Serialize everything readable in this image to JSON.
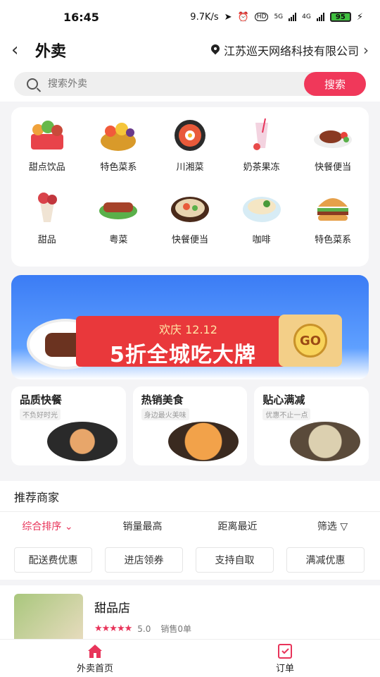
{
  "status": {
    "time": "16:45",
    "speed": "9.7K/s",
    "hd": "HD",
    "net1": "5G",
    "net2": "4G",
    "battery": "95"
  },
  "header": {
    "title": "外卖",
    "location": "江苏巡天网络科技有限公司"
  },
  "search": {
    "placeholder": "搜索外卖",
    "button": "搜索"
  },
  "categories": [
    {
      "label": "甜点饮品",
      "icon": "basket-icon"
    },
    {
      "label": "特色菜系",
      "icon": "fruit-basket-icon"
    },
    {
      "label": "川湘菜",
      "icon": "bibimbap-icon"
    },
    {
      "label": "奶茶果冻",
      "icon": "milkshake-icon"
    },
    {
      "label": "快餐便当",
      "icon": "steak-icon"
    },
    {
      "label": "甜品",
      "icon": "dessert-icon"
    },
    {
      "label": "粤菜",
      "icon": "skewer-icon"
    },
    {
      "label": "快餐便当",
      "icon": "hotpot-icon"
    },
    {
      "label": "咖啡",
      "icon": "noodle-bowl-icon"
    },
    {
      "label": "特色菜系",
      "icon": "burger-icon"
    }
  ],
  "banner": {
    "subtitle": "欢庆 12.12",
    "headline": "5折全城吃大牌",
    "go": "GO"
  },
  "promos": [
    {
      "title": "品质快餐",
      "tag": "不负好时光"
    },
    {
      "title": "热销美食",
      "tag": "身边最火美味"
    },
    {
      "title": "贴心满减",
      "tag": "优惠不止一点"
    }
  ],
  "recommend": {
    "title": "推荐商家"
  },
  "sorts": [
    "综合排序",
    "销量最高",
    "距离最近",
    "筛选"
  ],
  "filters": [
    "配送费优惠",
    "进店领券",
    "支持自取",
    "满减优惠"
  ],
  "shop": {
    "name": "甜品店",
    "stars": "★★★★★",
    "rating": "5.0",
    "sales": "销售0单"
  },
  "nav": [
    {
      "label": "外卖首页"
    },
    {
      "label": "订单"
    }
  ],
  "colors": {
    "accent": "#f0385a",
    "banner_blue": "#3b7cf5",
    "banner_red": "#e9383b"
  }
}
